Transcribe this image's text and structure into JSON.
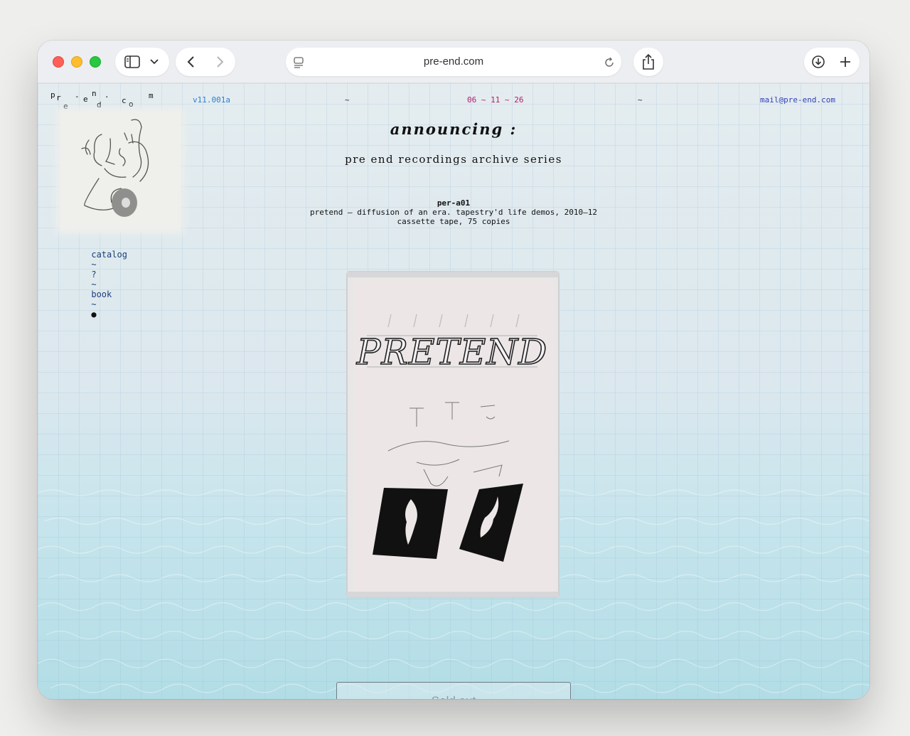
{
  "browser": {
    "url": "pre-end.com",
    "icons": [
      "sidebar-icon",
      "chevron-down-icon",
      "back-icon",
      "forward-icon",
      "page-icon",
      "reload-icon",
      "share-icon",
      "download-icon",
      "plus-icon"
    ]
  },
  "site": {
    "logo_letters": [
      "p",
      "r",
      "e",
      "-",
      "e",
      "n",
      "d",
      ".",
      "c",
      "o",
      "m"
    ],
    "version": "v11.001a",
    "tilde_left": "~",
    "date": "06 ~ 11 ~ 26",
    "tilde_right": "~",
    "email": "mail@pre-end.com",
    "menu": {
      "catalog": "catalog",
      "sep1": "~",
      "question": "?",
      "sep2": "~",
      "book": "book",
      "sep3": "~",
      "dot": "●"
    },
    "headline": "announcing :",
    "series_title": "pre end recordings archive series",
    "release": {
      "code": "per-a01",
      "title_line": "pretend – diffusion of an era. tapestry'd life demos, 2010–12",
      "format": "cassette tape, 75 copies"
    },
    "cassette_cover_text": "PRETEND",
    "button_label": "Sold out"
  },
  "colors": {
    "version": "#2a7fd4",
    "date": "#b0206e",
    "email": "#2f3fb8",
    "menu": "#1c3f7a"
  }
}
